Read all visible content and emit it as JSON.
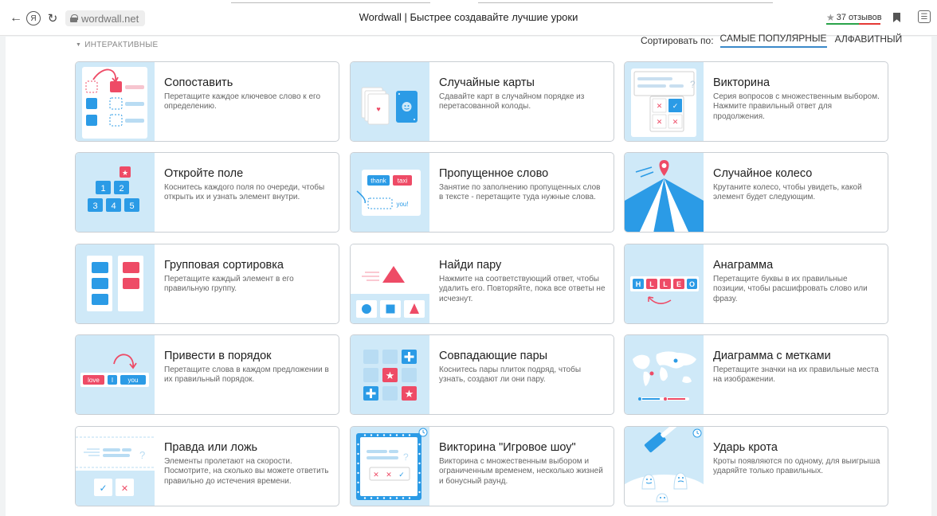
{
  "browser": {
    "url": "wordwall.net",
    "title": "Wordwall | Быстрее создавайте лучшие уроки",
    "reviews": "37 отзывов",
    "yandex_glyph": "Я"
  },
  "filter": {
    "label": "ИНТЕРАКТИВНЫЕ"
  },
  "sort": {
    "label": "Сортировать по:",
    "options": [
      "САМЫЕ ПОПУЛЯРНЫЕ",
      "АЛФАВИТНЫЙ"
    ]
  },
  "icons": [
    "back-arrow-icon",
    "yandex-icon",
    "reload-icon",
    "lock-icon",
    "star-icon",
    "bookmark-icon",
    "extension-icon"
  ],
  "colors": {
    "thumb_bg": "#cfe9f8",
    "accent_blue": "#2b9be6",
    "accent_red": "#ee4b66",
    "sort_underline": "#3a89c9"
  },
  "cards": [
    {
      "title": "Сопоставить",
      "desc": "Перетащите каждое ключевое слово к его определению."
    },
    {
      "title": "Случайные карты",
      "desc": "Сдавайте карт в случайном порядке из перетасованной колоды."
    },
    {
      "title": "Викторина",
      "desc": "Серия вопросов с множественным выбором. Нажмите правильный ответ для продолжения."
    },
    {
      "title": "Откройте поле",
      "desc": "Коснитесь каждого поля по очереди, чтобы открыть их и узнать элемент внутри.",
      "thumb_numbers": [
        "1",
        "2",
        "3",
        "4",
        "5"
      ]
    },
    {
      "title": "Пропущенное слово",
      "desc": "Занятие по заполнению пропущенных слов в тексте - перетащите туда нужные слова.",
      "thumb_words": [
        "thank",
        "taxi",
        "you!"
      ]
    },
    {
      "title": "Случайное колесо",
      "desc": "Крутаните колесо, чтобы увидеть, какой элемент будет следующим."
    },
    {
      "title": "Групповая сортировка",
      "desc": "Перетащите каждый элемент в его правильную группу."
    },
    {
      "title": "Найди пару",
      "desc": "Нажмите на соответствующий ответ, чтобы удалить его. Повторяйте, пока все ответы не исчезнут."
    },
    {
      "title": "Анаграмма",
      "desc": "Перетащите буквы в их правильные позиции, чтобы расшифровать слово или фразу.",
      "thumb_letters": [
        "H",
        "L",
        "L",
        "E",
        "O"
      ]
    },
    {
      "title": "Привести в порядок",
      "desc": "Перетащите слова в каждом предложении в их правильный порядок.",
      "thumb_words": [
        "love",
        "I",
        "you"
      ]
    },
    {
      "title": "Совпадающие пары",
      "desc": "Коснитесь пары плиток подряд, чтобы узнать, создают ли они пару."
    },
    {
      "title": "Диаграмма с метками",
      "desc": "Перетащите значки на их правильные места на изображении."
    },
    {
      "title": "Правда или ложь",
      "desc": "Элементы пролетают на скорости. Посмотрите, на сколько вы можете ответить правильно до истечения времени."
    },
    {
      "title": "Викторина \"Игровое шоу\"",
      "desc": "Викторина с множественным выбором и ограниченным временем, несколько жизней и бонусный раунд."
    },
    {
      "title": "Ударь крота",
      "desc": "Кроты появляются по одному, для выигрыша ударяйте только правильных."
    }
  ]
}
